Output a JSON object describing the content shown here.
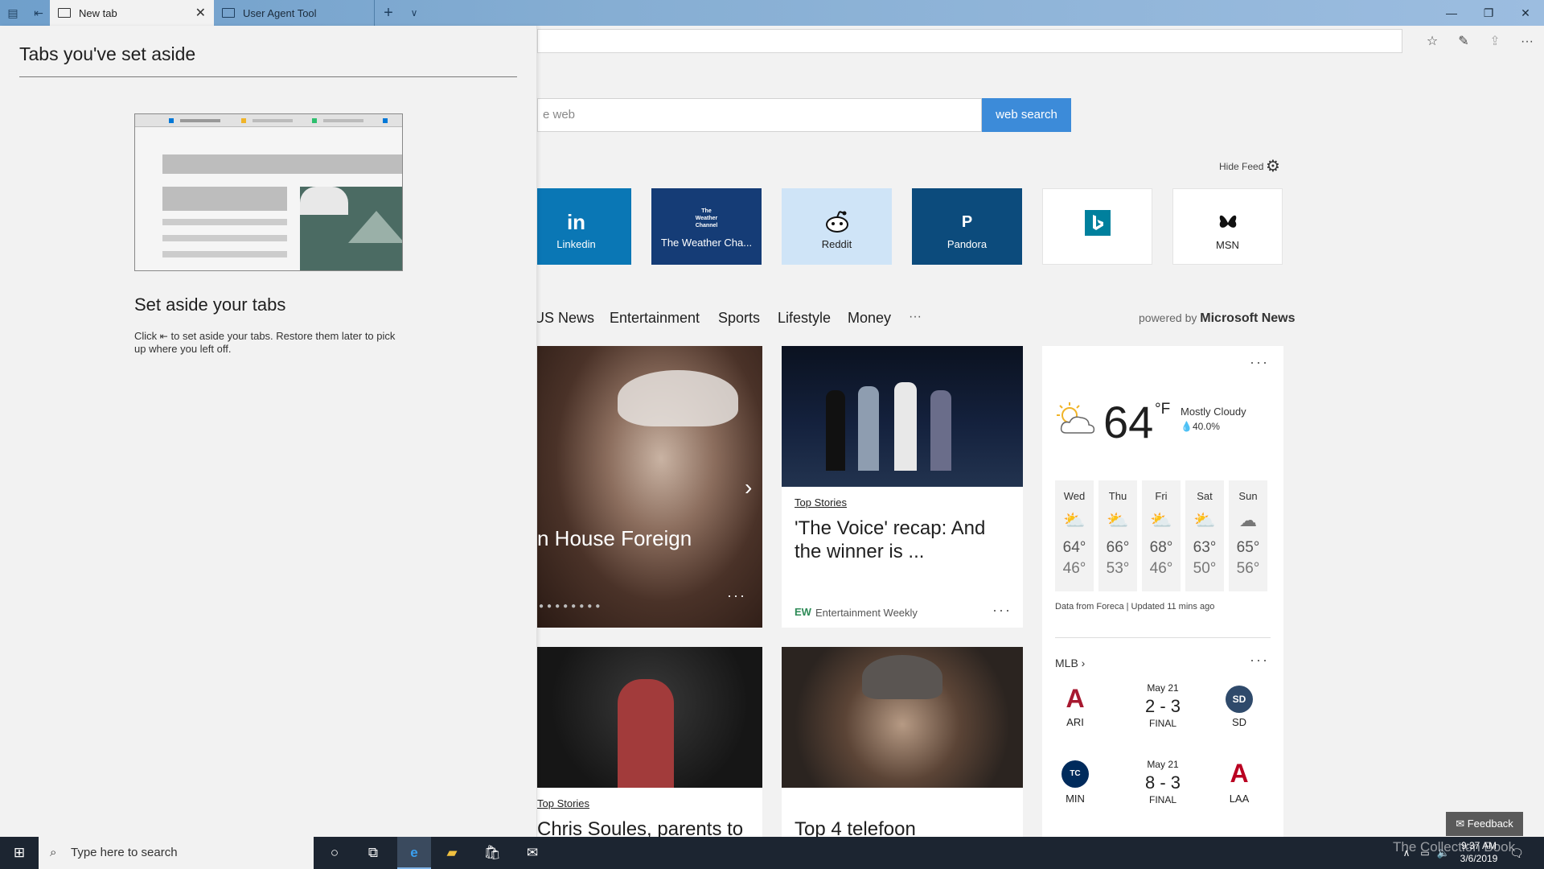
{
  "tabs": [
    {
      "label": "New tab"
    },
    {
      "label": "User Agent Tool"
    }
  ],
  "search": {
    "placeholder": "e web",
    "button": "web search"
  },
  "feed": {
    "hide_label": "Hide Feed"
  },
  "tiles": [
    {
      "glyph": "in",
      "label": "Linkedin",
      "bg": "#0a77b5"
    },
    {
      "glyph": "The Weather Channel",
      "label": "The Weather Cha...",
      "bg": "#153c76"
    },
    {
      "glyph": "",
      "label": "Reddit",
      "bg": "#cfe4f7"
    },
    {
      "glyph": "P",
      "label": "Pandora",
      "bg": "#0c4b7c"
    },
    {
      "glyph": "",
      "label": "",
      "bg": "#ffffff"
    },
    {
      "glyph": "",
      "label": "MSN",
      "bg": "#ffffff"
    }
  ],
  "categories": [
    "US News",
    "Entertainment",
    "Sports",
    "Lifestyle",
    "Money",
    "···"
  ],
  "powered": {
    "prefix": "powered by",
    "brand": "Microsoft News"
  },
  "cards": {
    "hero": {
      "headline": "n House Foreign"
    },
    "voice": {
      "tag": "Top Stories",
      "headline": "'The Voice' recap: And the winner is ...",
      "source_logo": "EW",
      "source": "Entertainment Weekly"
    },
    "dwts": {
      "tag": "Top Stories",
      "headline": "Chris Soules, parents to"
    },
    "telefoon": {
      "headline": "Top 4 telefoon"
    }
  },
  "weather": {
    "temp": "64",
    "unit": "°F",
    "condition": "Mostly Cloudy",
    "precip": "40.0%",
    "days": [
      {
        "name": "Wed",
        "hi": "64°",
        "lo": "46°",
        "icon": "partly-sunny-icon"
      },
      {
        "name": "Thu",
        "hi": "66°",
        "lo": "53°",
        "icon": "partly-sunny-icon"
      },
      {
        "name": "Fri",
        "hi": "68°",
        "lo": "46°",
        "icon": "partly-sunny-icon"
      },
      {
        "name": "Sat",
        "hi": "63°",
        "lo": "50°",
        "icon": "partly-sunny-icon"
      },
      {
        "name": "Sun",
        "hi": "65°",
        "lo": "56°",
        "icon": "cloudy-icon"
      }
    ],
    "footer": "Data from Foreca | Updated 11 mins ago"
  },
  "mlb": {
    "title": "MLB",
    "games": [
      {
        "away": "ARI",
        "home": "SD",
        "date": "May 21",
        "score": "2 - 3",
        "status": "FINAL",
        "away_color": "#a71930",
        "home_color": "#2f4a6b"
      },
      {
        "away": "MIN",
        "home": "LAA",
        "date": "May 21",
        "score": "8 - 3",
        "status": "FINAL",
        "away_color": "#002b5c",
        "home_color": "#ba0021"
      }
    ]
  },
  "panel": {
    "title": "Tabs you've set aside",
    "heading": "Set aside your tabs",
    "text_a": "Click",
    "text_b": "to set aside your tabs. Restore them later to pick up where you left off."
  },
  "taskbar": {
    "search_placeholder": "Type here to search",
    "time": "9:37 AM",
    "date": "3/6/2019",
    "feedback": "Feedback",
    "watermark": "The Collection Book"
  }
}
